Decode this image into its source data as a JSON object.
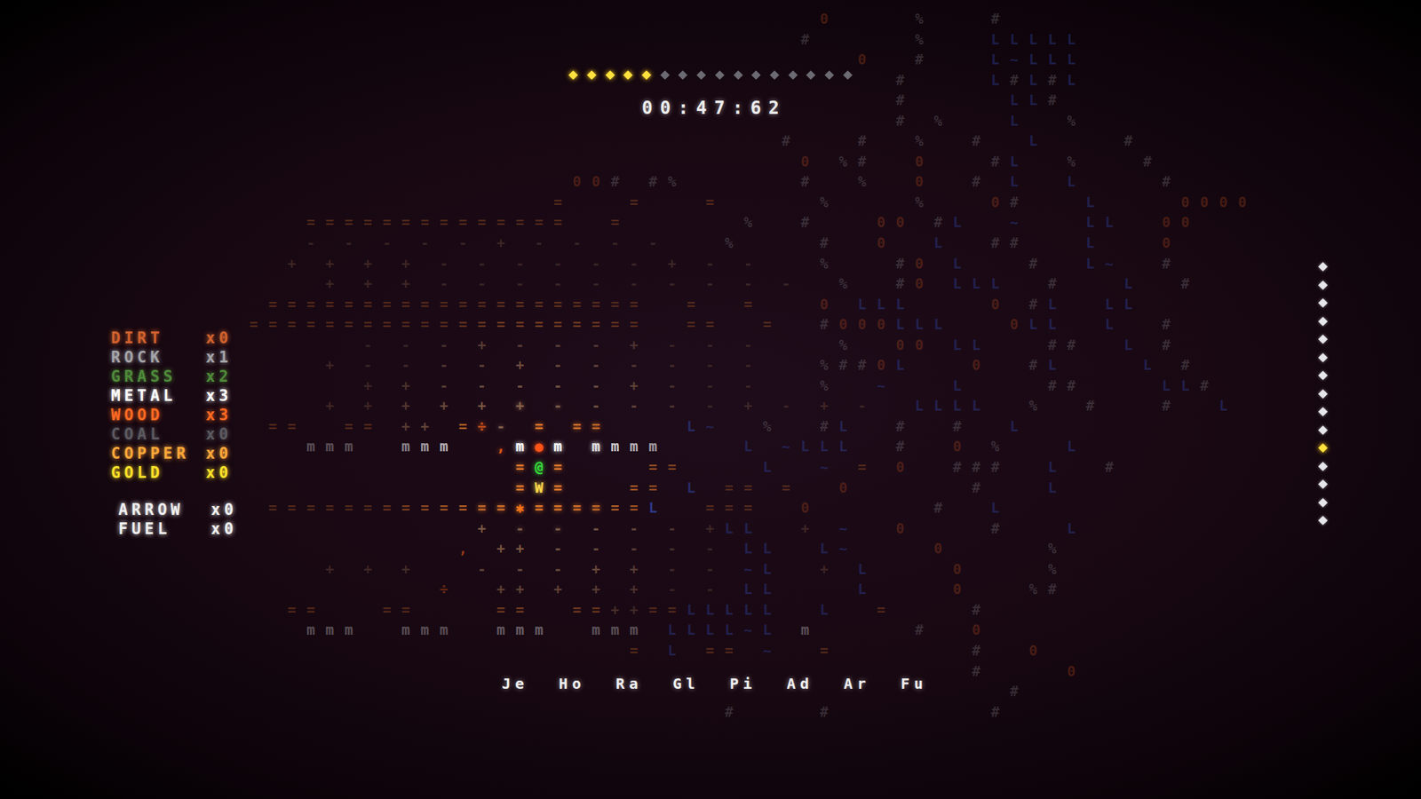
{
  "timer": "00:47:62",
  "progress": [
    {
      "filled": true
    },
    {
      "filled": true
    },
    {
      "filled": true
    },
    {
      "filled": true
    },
    {
      "filled": true
    },
    {
      "filled": false
    },
    {
      "filled": false
    },
    {
      "filled": false
    },
    {
      "filled": false
    },
    {
      "filled": false
    },
    {
      "filled": false
    },
    {
      "filled": false
    },
    {
      "filled": false
    },
    {
      "filled": false
    },
    {
      "filled": false
    },
    {
      "filled": false
    }
  ],
  "inventory": [
    {
      "name": "DIRT",
      "count": "x0",
      "color": "#d0622e"
    },
    {
      "name": "ROCK",
      "count": "x1",
      "color": "#a4a4a8"
    },
    {
      "name": "GRASS",
      "count": "x2",
      "color": "#4f8a3a"
    },
    {
      "name": "METAL",
      "count": "x3",
      "color": "#ffffff"
    },
    {
      "name": "WOOD",
      "count": "x3",
      "color": "#ff6a22"
    },
    {
      "name": "COAL",
      "count": "x0",
      "color": "#5c5a60"
    },
    {
      "name": "COPPER",
      "count": "x0",
      "color": "#ffa83a"
    },
    {
      "name": "GOLD",
      "count": "x0",
      "color": "#ffe22a"
    }
  ],
  "ammo": [
    {
      "name": "ARROW",
      "count": "x0"
    },
    {
      "name": "FUEL",
      "count": "x0"
    }
  ],
  "depth": [
    {
      "selected": false
    },
    {
      "selected": false
    },
    {
      "selected": false
    },
    {
      "selected": false
    },
    {
      "selected": false
    },
    {
      "selected": false
    },
    {
      "selected": false
    },
    {
      "selected": false
    },
    {
      "selected": false
    },
    {
      "selected": false
    },
    {
      "selected": true
    },
    {
      "selected": false
    },
    {
      "selected": false
    },
    {
      "selected": false
    },
    {
      "selected": false
    }
  ],
  "hotbar": [
    "Je",
    "Ho",
    "Ra",
    "Gl",
    "Pi",
    "Ad",
    "Ar",
    "Fu"
  ],
  "map": {
    "rows": [
      "                              0    %   #",
      "                             #     %   LLLLL",
      "                                0  #   L~LLL",
      "                                  #    L#L#L",
      "                                  #     LL#",
      "                                  # %   L  %",
      "                            #   #  %  #  L    #",
      "                             0 %#  0   #L  %   #",
      "                 00# #%      #  %  0  # L  L    #",
      "                =   =   =     %    %   0#   L    0000",
      "   ==============  =      %  #   00 #L  ~   LL  00",
      "   - - - - - + - - - -   %    #  0  L  ##   L   0",
      "  + + + + - - - - - - + - -   %   #0 L   #  L~  #",
      "    + + + - - - - - - - - - -  %  #0 LLL  #   L  #",
      " ====================  =  =   0 LLL    0 #L  LL",
      "=====================  ==  =  #000LLL   0LL  L  #",
      "      - - - + - - - + - - -    %  00 LL   ##  L #",
      "    + - - - - + - - - - - -   %##0L   0  #L    L #",
      "      + + - - - - - + - - -   %  ~   L    ##    LL#",
      "    + + + + + + - - - - - + - + -  LLLL  %  #   #  L",
      " ==  == ++ =÷- = ==    L~  %  #L  #  #  L",
      "   mmm  mmm  ,m●m mmmm    L ~LLL  #  0 %   L",
      "              =@=    ==    L  ~ = 0  ###  L  #",
      "              =W=   == L == =  0      #   L",
      " =============✱======L  ===  0      #  L",
      "            + - - - - - +LL  + ~  0    #   L",
      "           , ++ - - - - - LL  L~    0     %",
      "    + + +   - - - + + - - ~L  + L    0    %",
      "          ÷  ++ + + + - - LL    L    0   %#",
      "  ==   ==    ==  ==++==LLLLL  L  =    #",
      "   mmm  mmm  mmm  mmm LLLL~L m     #  0",
      "                    = L == ~  =       #  0",
      "                                      #    0",
      "                                        #",
      "                         #    #        #"
    ]
  }
}
